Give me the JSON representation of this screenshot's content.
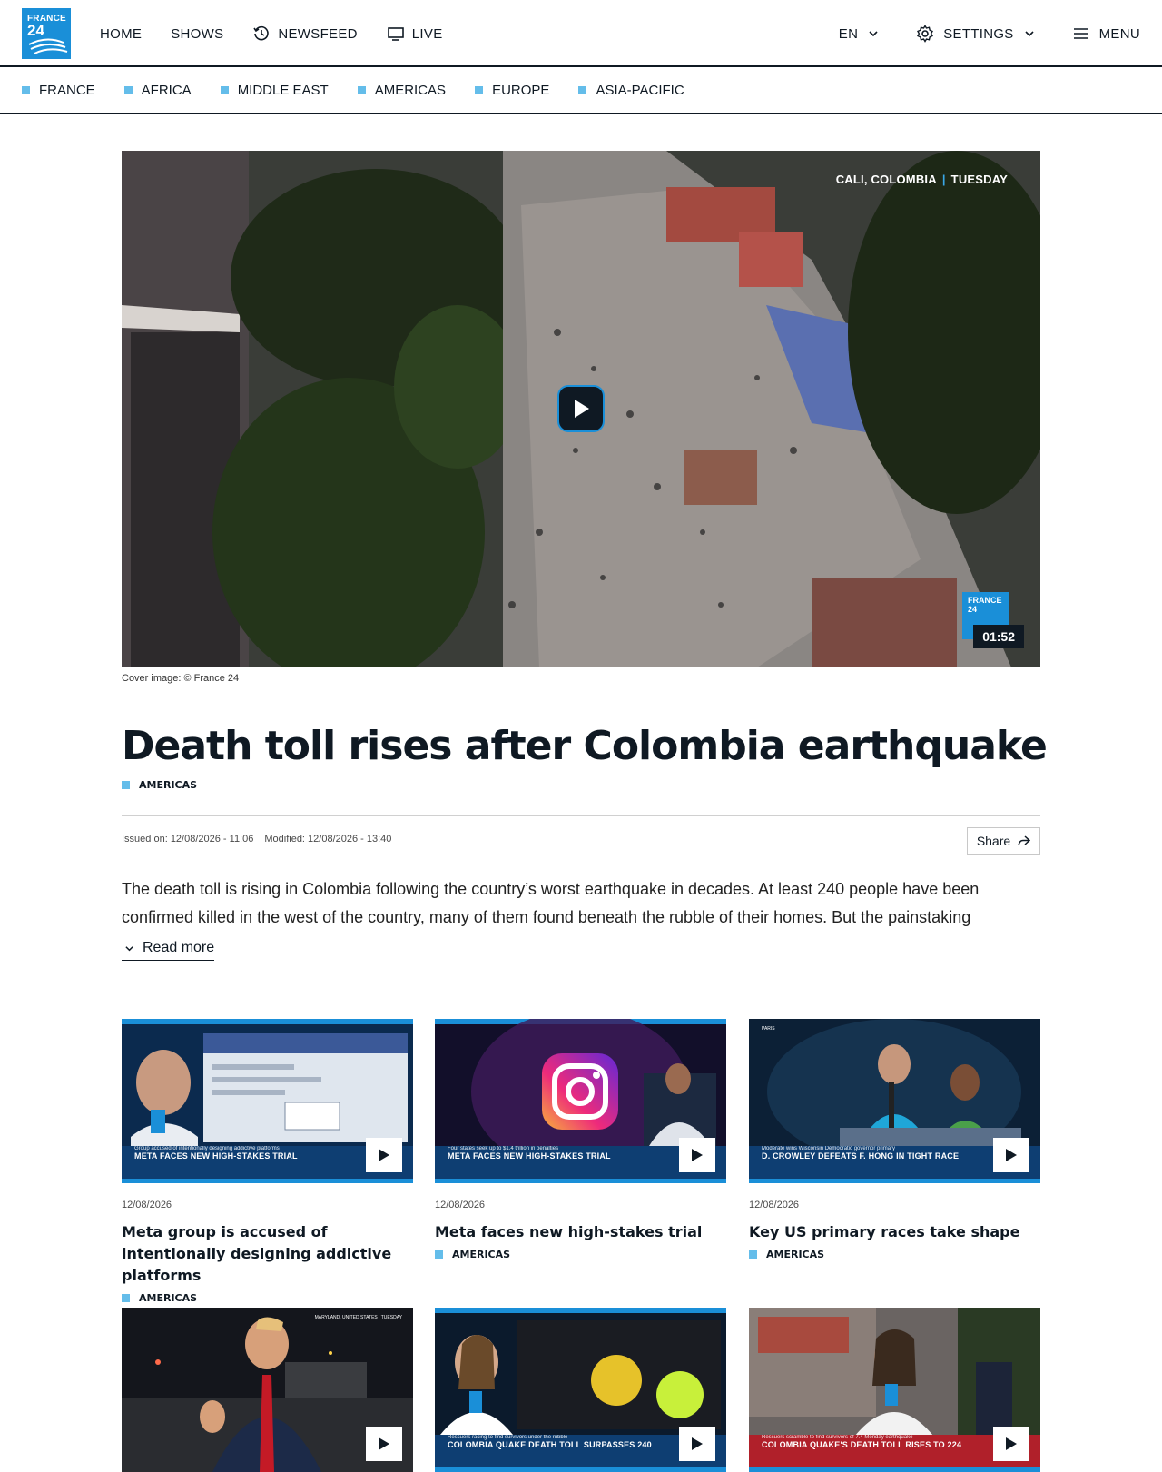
{
  "brand": {
    "logo_line1": "FRANCE",
    "logo_line2": "24"
  },
  "nav": {
    "home": "HOME",
    "shows": "SHOWS",
    "newsfeed": "NEWSFEED",
    "live": "LIVE",
    "language": "EN",
    "settings": "SETTINGS",
    "menu": "MENU"
  },
  "regions": [
    "FRANCE",
    "AFRICA",
    "MIDDLE EAST",
    "AMERICAS",
    "EUROPE",
    "ASIA-PACIFIC"
  ],
  "hero": {
    "location": "CALI, COLOMBIA",
    "day": "TUESDAY",
    "watermark_line1": "FRANCE",
    "watermark_line2": "24",
    "duration": "01:52",
    "credit": "Cover image: © France 24"
  },
  "article": {
    "title": "Death toll rises after Colombia earthquake",
    "tag": "AMERICAS",
    "issued": "Issued on: 12/08/2026 - 11:06",
    "modified": "Modified: 12/08/2026 - 13:40",
    "share": "Share",
    "lead": "The death toll is rising in Colombia following the country’s worst earthquake in decades. At least 240 people have been confirmed killed in the west of the country, many of them found beneath the rubble of their homes. But the painstaking",
    "read_more": "Read more"
  },
  "cards": [
    {
      "date": "12/08/2026",
      "title": "Meta group is accused of intentionally designing addictive platforms",
      "tag": "AMERICAS",
      "cap_small": "Group accused of intentionally designing addictive platforms",
      "cap_big": "META FACES NEW HIGH-STAKES TRIAL",
      "loc": ""
    },
    {
      "date": "12/08/2026",
      "title": "Meta faces new high-stakes trial",
      "tag": "AMERICAS",
      "cap_small": "Four states seek up to $1.4 trillion in penalties",
      "cap_big": "META FACES NEW HIGH-STAKES TRIAL",
      "loc": ""
    },
    {
      "date": "12/08/2026",
      "title": "Key US primary races take shape",
      "tag": "AMERICAS",
      "cap_small": "Moderate wins Wisconsin Democratic governor primary",
      "cap_big": "D. CROWLEY DEFEATS F. HONG IN TIGHT RACE",
      "loc": "PARIS"
    },
    {
      "date": "",
      "title": "",
      "tag": "",
      "cap_small": "",
      "cap_big": "",
      "loc": "MARYLAND, UNITED STATES | TUESDAY"
    },
    {
      "date": "",
      "title": "",
      "tag": "",
      "cap_small": "Rescuers racing to find survivors under the rubble",
      "cap_big": "COLOMBIA QUAKE DEATH TOLL SURPASSES 240",
      "loc": ""
    },
    {
      "date": "",
      "title": "",
      "tag": "",
      "cap_small": "Rescuers scramble to find survivors of 7.4 Monday earthquake",
      "cap_big": "COLOMBIA QUAKE'S DEATH TOLL RISES TO 224",
      "loc": ""
    }
  ],
  "colors": {
    "accent": "#1a8fd8",
    "region_marker": "#64bdea",
    "text": "#0f1923"
  }
}
